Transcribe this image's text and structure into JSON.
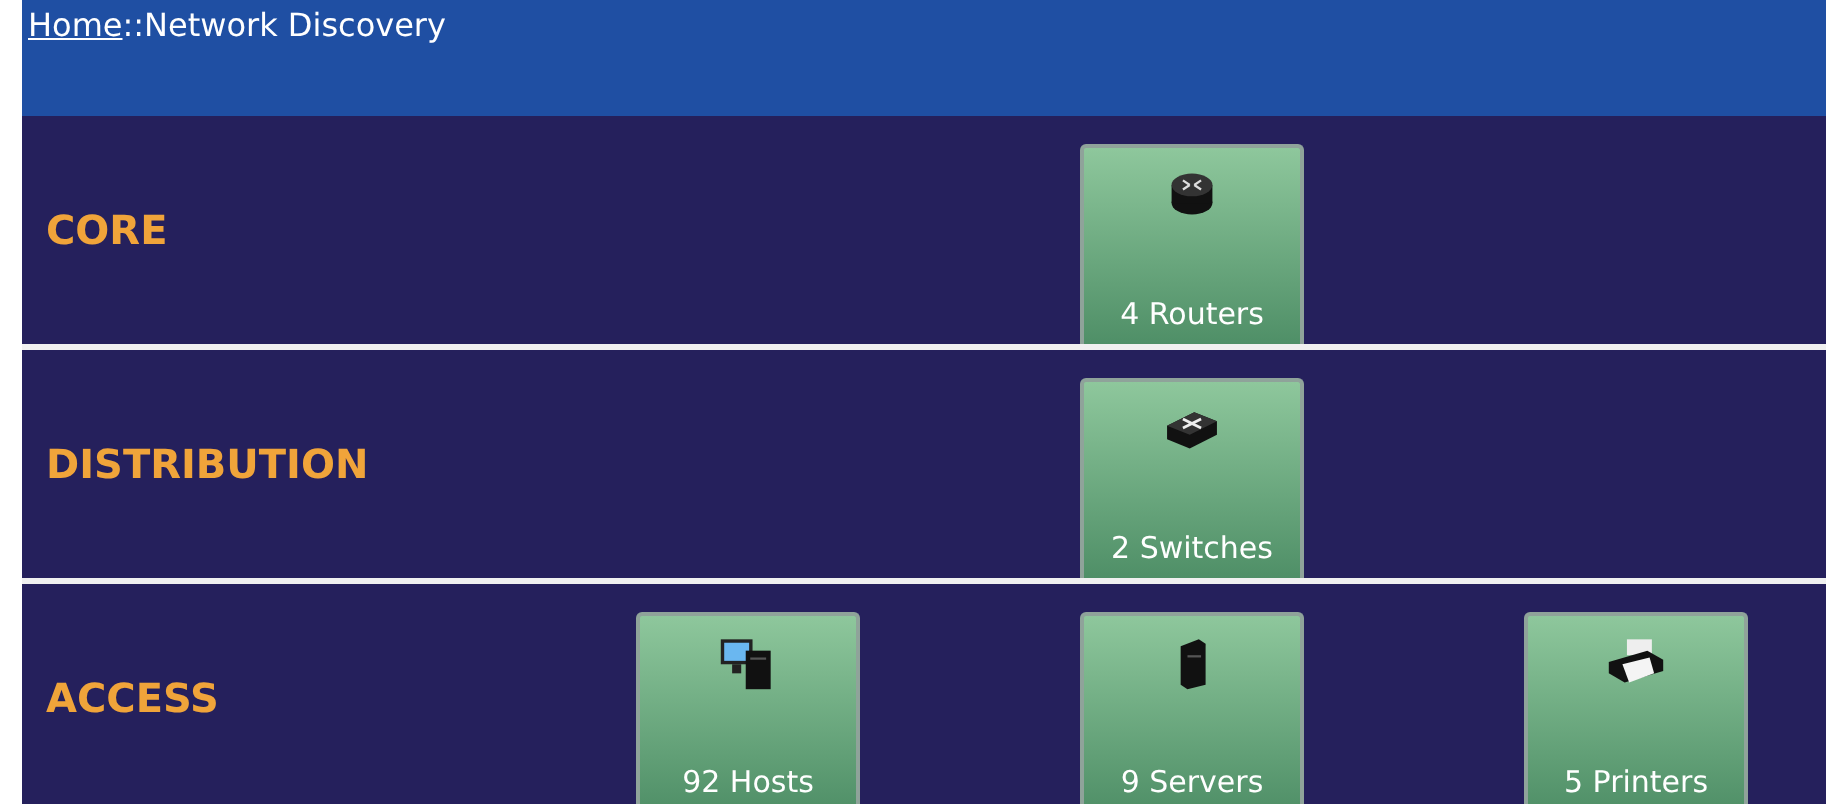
{
  "breadcrumb": {
    "link": "Home",
    "separator": "::",
    "current": "Network Discovery"
  },
  "layers": [
    {
      "name": "CORE",
      "devices": [
        {
          "kind": "router",
          "label": "4 Routers"
        }
      ]
    },
    {
      "name": "DISTRIBUTION",
      "devices": [
        {
          "kind": "switch",
          "label": "2 Switches"
        }
      ]
    },
    {
      "name": "ACCESS",
      "devices": [
        {
          "kind": "host",
          "label": "92 Hosts"
        },
        {
          "kind": "server",
          "label": "9 Servers"
        },
        {
          "kind": "printer",
          "label": "5 Printers"
        }
      ]
    }
  ]
}
